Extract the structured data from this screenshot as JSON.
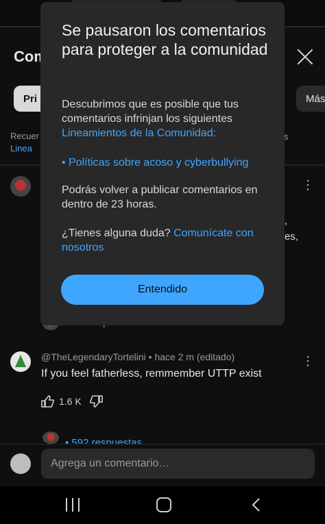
{
  "header": {
    "comments_title_fragment": "Com"
  },
  "filters": {
    "primary_fragment": "Pri",
    "more_fragment": "Más"
  },
  "reminder": {
    "line1_fragment": "Recuer",
    "line2_fragment": "Linea",
    "tail_fragment": "s"
  },
  "modal": {
    "title": "Se pausaron los comentarios para proteger a la comunidad",
    "body_intro": "Descubrimos que es posible que tus comentarios infrinjan los siguientes",
    "guidelines_link": "Lineamientos de la Comunidad",
    "guidelines_colon": ":",
    "policy_item": "• Políticas sobre acoso y cyberbullying",
    "repost_notice": "Podrás volver a publicar comentarios en dentro de 23 horas.",
    "question_text": "¿Tienes alguna duda?",
    "contact_link": "Comunícate con nosotros",
    "ok_button": "Entendido"
  },
  "background_comment_fragments": {
    "frag_a": ",",
    "frag_b": "es,",
    "frag_c": "p"
  },
  "comment": {
    "author": "@TheLegendaryTortelini",
    "separator": "•",
    "time": "hace 2 m (editado)",
    "text": "If you feel fatherless, remmember UTTP exist",
    "likes": "1.6 K"
  },
  "replies": {
    "label": "• 592 respuestas"
  },
  "composer": {
    "placeholder": "Agrega un comentario…"
  },
  "colors": {
    "accent": "#3ea6ff",
    "modal_bg": "#282828",
    "page_bg": "#0f0f0f"
  },
  "icons": [
    "close-icon",
    "more-vert-icon",
    "thumb-up-icon",
    "thumb-down-icon",
    "recents-icon",
    "home-icon",
    "back-icon"
  ]
}
